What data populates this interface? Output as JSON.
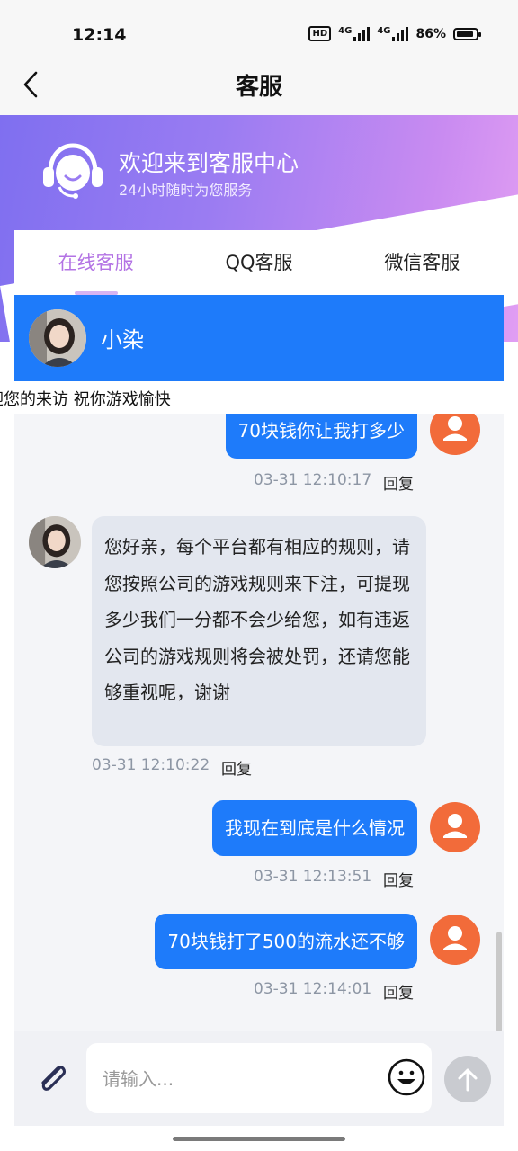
{
  "status_bar": {
    "time": "12:14",
    "hd_badge": "HD",
    "network_1": "4G",
    "network_2": "4G",
    "battery": "86%",
    "battery_level": 0.86
  },
  "nav": {
    "title": "客服",
    "back_icon": "chevron-left-icon"
  },
  "banner": {
    "title": "欢迎来到客服中心",
    "subtitle": "24小时随时为您服务",
    "icon": "headset-agent-icon",
    "gradient_start": "#7f6ff0",
    "gradient_end": "#e19ef3"
  },
  "tabs": [
    {
      "label": "在线客服",
      "active": true
    },
    {
      "label": "QQ客服",
      "active": false
    },
    {
      "label": "微信客服",
      "active": false
    }
  ],
  "agent": {
    "name": "小染",
    "header_color": "#1e7bfa"
  },
  "marquee": {
    "text": "迎您的来访 祝你游戏愉快"
  },
  "messages": [
    {
      "sender": "user",
      "text": "70块钱你让我打多少",
      "time": "03-31 12:10:17",
      "reply_label": "回复"
    },
    {
      "sender": "agent",
      "text": "您好亲，每个平台都有相应的规则，请您按照公司的游戏规则来下注，可提现多少我们一分都不会少给您，如有违返公司的游戏规则将会被处罚，还请您能够重视呢，谢谢",
      "time": "03-31 12:10:22",
      "reply_label": "回复"
    },
    {
      "sender": "user",
      "text": "我现在到底是什么情况",
      "time": "03-31 12:13:51",
      "reply_label": "回复"
    },
    {
      "sender": "user",
      "text": "70块钱打了500的流水还不够",
      "time": "03-31 12:14:01",
      "reply_label": "回复"
    }
  ],
  "composer": {
    "placeholder": "请输入...",
    "attach_icon": "paperclip-icon",
    "emoji_icon": "smiley-icon",
    "send_icon": "arrow-up-icon"
  },
  "colors": {
    "accent": "#1e7bfa",
    "tab_active": "#b373e4",
    "user_avatar": "#f26b3a"
  }
}
